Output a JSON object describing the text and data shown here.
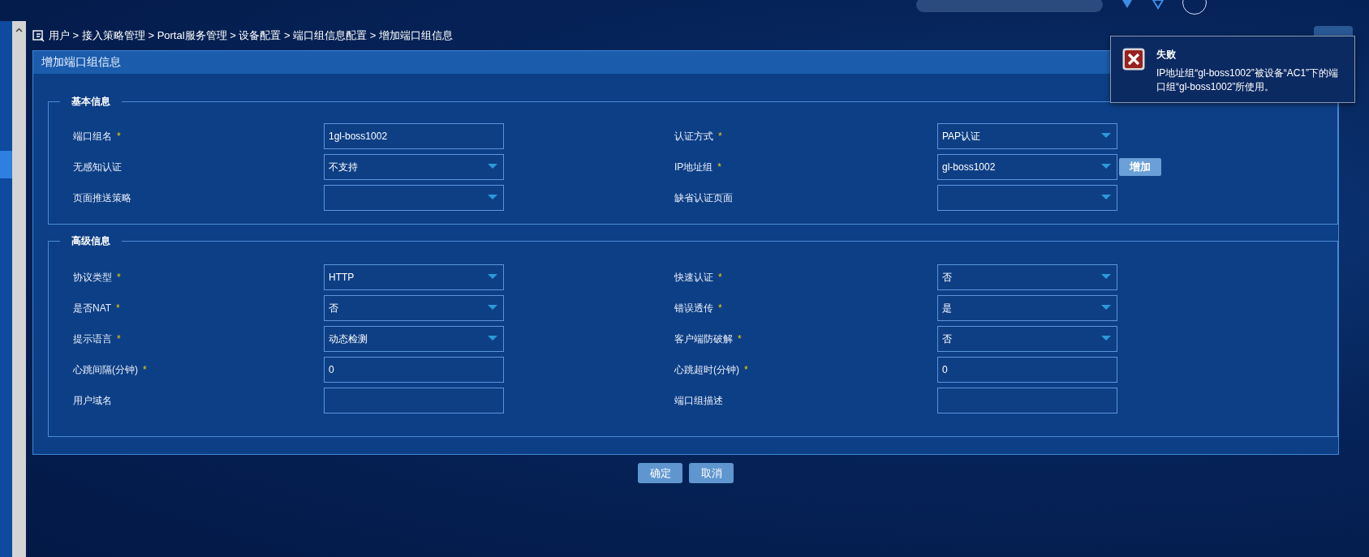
{
  "breadcrumb": "用户 > 接入策略管理 > Portal服务管理 > 设备配置 > 端口组信息配置 > 增加端口组信息",
  "help_button": {
    "kind": "help"
  },
  "panel_title": "增加端口组信息",
  "sections": [
    {
      "title": "基本信息",
      "fields": [
        {
          "label": "端口组名",
          "required_mark": "*",
          "kind": "text",
          "value": "1gl-boss1002"
        },
        {
          "label": "认证方式",
          "required_mark": "*",
          "kind": "select",
          "value": "PAP认证"
        },
        {
          "label": "无感知认证",
          "kind": "select",
          "value": "不支持"
        },
        {
          "label": "IP地址组",
          "required_mark": "*",
          "kind": "select",
          "value": "gl-boss1002",
          "button": "增加"
        },
        {
          "label": "页面推送策略",
          "kind": "select"
        },
        {
          "label": "缺省认证页面",
          "kind": "select"
        }
      ]
    },
    {
      "title": "高级信息",
      "fields": [
        {
          "label": "协议类型",
          "required_mark": "*",
          "kind": "select",
          "value": "HTTP"
        },
        {
          "label": "快速认证",
          "required_mark": "*",
          "kind": "select",
          "value": "否"
        },
        {
          "label": "是否NAT",
          "required_mark": "*",
          "kind": "select",
          "value": "否"
        },
        {
          "label": "错误透传",
          "required_mark": "*",
          "kind": "select",
          "value": "是"
        },
        {
          "label": "提示语言",
          "required_mark": "*",
          "kind": "select",
          "value": "动态检测"
        },
        {
          "label": "客户端防破解",
          "required_mark": "*",
          "kind": "select",
          "value": "否"
        },
        {
          "label": "心跳间隔(分钟)",
          "required_mark": "*",
          "kind": "text",
          "value": "0"
        },
        {
          "label": "心跳超时(分钟)",
          "required_mark": "*",
          "kind": "text",
          "value": "0"
        },
        {
          "label": "用户域名",
          "kind": "text"
        },
        {
          "label": "端口组描述",
          "kind": "text"
        }
      ]
    }
  ],
  "buttons": [
    "确定",
    "取消"
  ],
  "toast": {
    "title": "失败",
    "message": "IP地址组“gl-boss1002”被设备“AC1”下的端口组“gl-boss1002”所使用。"
  }
}
